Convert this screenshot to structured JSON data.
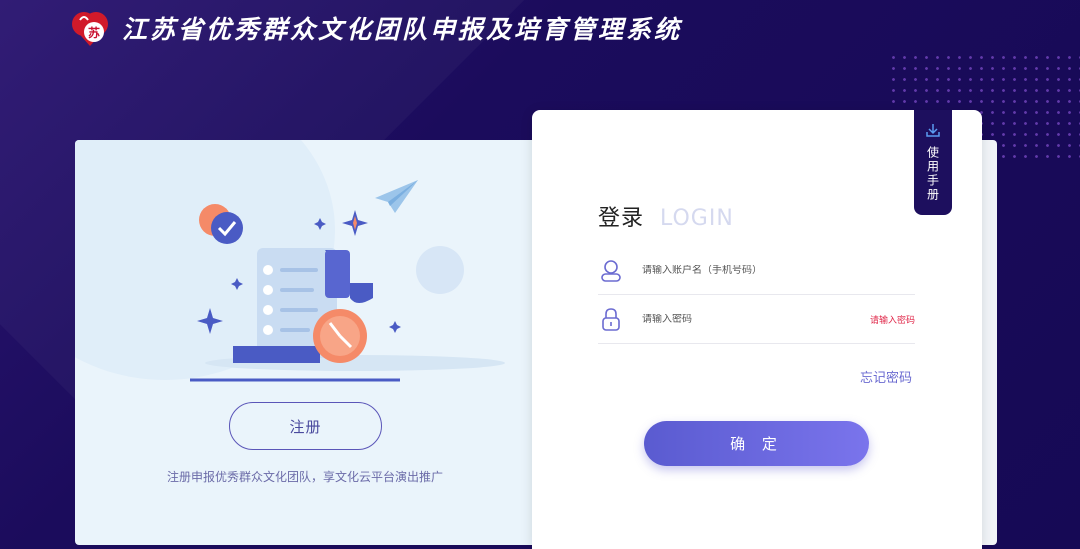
{
  "header": {
    "logo_char": "苏",
    "title": "江苏省优秀群众文化团队申报及培育管理系统"
  },
  "left_panel": {
    "register_label": "注册",
    "register_desc": "注册申报优秀群众文化团队，享文化云平台演出推广"
  },
  "login": {
    "title": "登录",
    "subtitle": "LOGIN",
    "username_placeholder": "请输入账户名（手机号码）",
    "password_placeholder": "请输入密码",
    "password_error": "请输入密码",
    "forgot_label": "忘记密码",
    "confirm_label": "确 定"
  },
  "manual_tab": {
    "label": "使用手册",
    "icon": "download-icon"
  },
  "colors": {
    "background": "#1b0c5c",
    "accent": "#6b6bd1",
    "error": "#e0284a",
    "logo_red": "#c8102e"
  }
}
